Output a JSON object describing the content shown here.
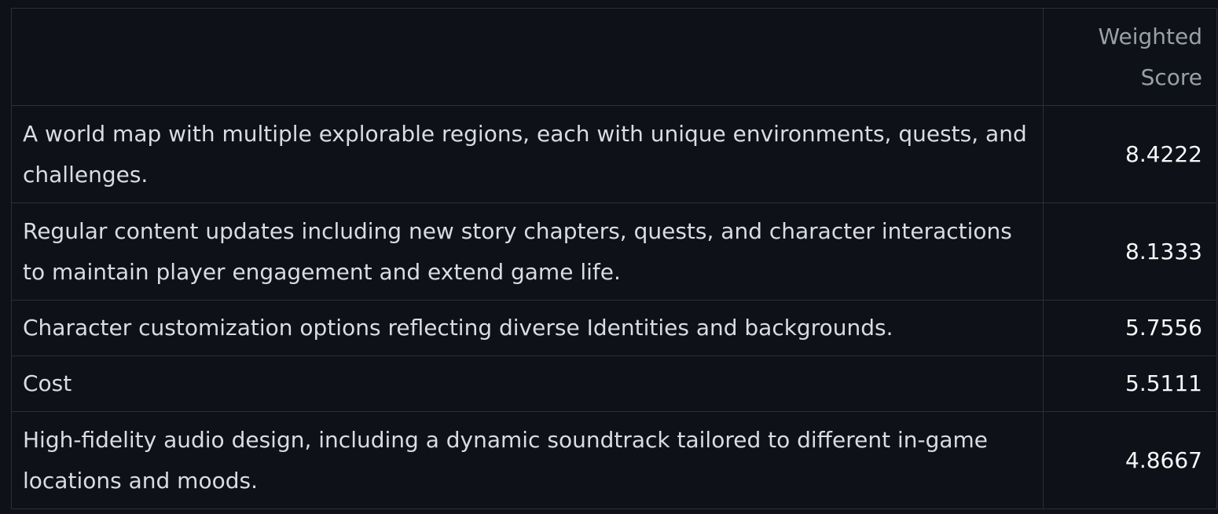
{
  "table": {
    "header": {
      "first_col": "",
      "score_col": "Weighted Score"
    },
    "rows": [
      {
        "label": "A world map with multiple explorable regions, each with unique environments, quests, and challenges.",
        "score": "8.4222"
      },
      {
        "label": "Regular content updates including new story chapters, quests, and character interactions to maintain player engagement and extend game life.",
        "score": "8.1333"
      },
      {
        "label": "Character customization options reflecting diverse Identities and backgrounds.",
        "score": "5.7556"
      },
      {
        "label": "Cost",
        "score": "5.5111"
      },
      {
        "label": "High-fidelity audio design, including a dynamic soundtrack tailored to different in-game locations and moods.",
        "score": "4.8667"
      }
    ]
  }
}
